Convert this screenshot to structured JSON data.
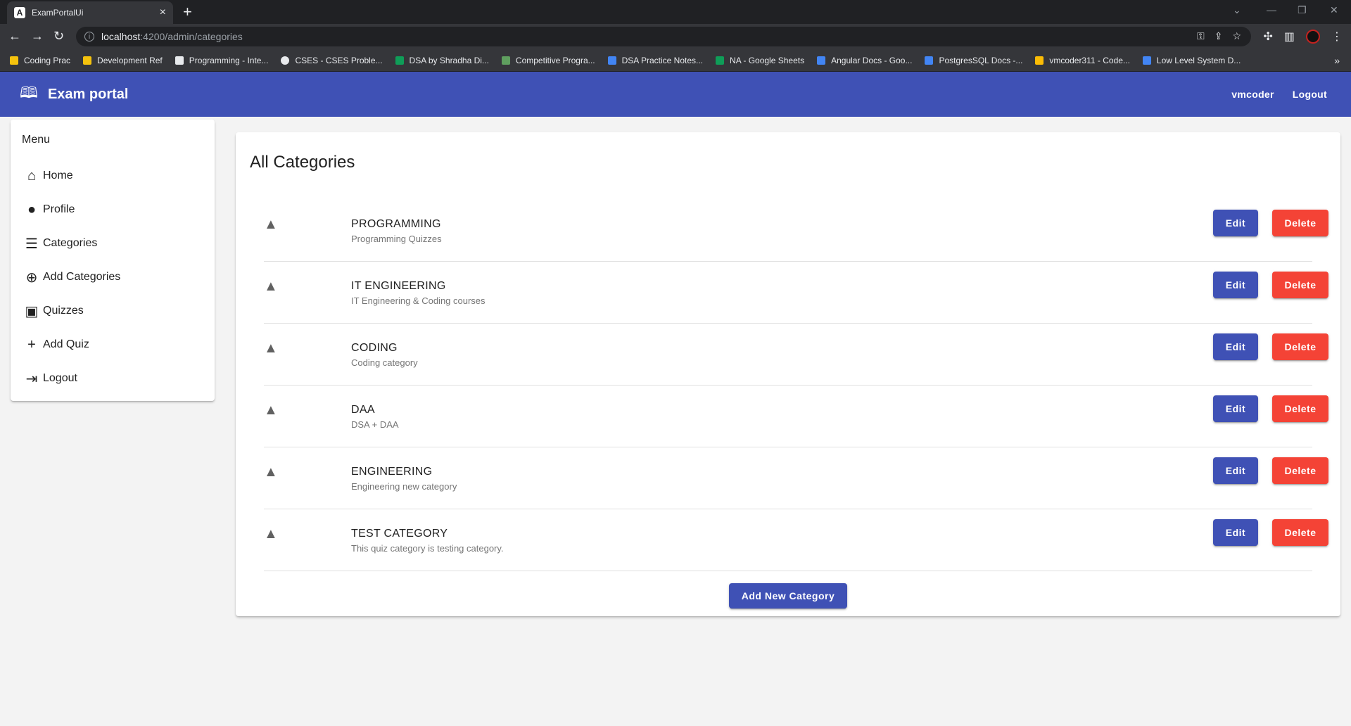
{
  "browser": {
    "tab_title": "ExamPortalUi",
    "tab_favicon": "A",
    "url_host": "localhost",
    "url_path": ":4200/admin/categories",
    "bookmarks": [
      {
        "label": "Coding Prac",
        "color": "#f4c20d"
      },
      {
        "label": "Development Ref",
        "color": "#f4c20d"
      },
      {
        "label": "Programming - Inte...",
        "color": "#ffffff"
      },
      {
        "label": "CSES - CSES Proble...",
        "color": "#e8eaed"
      },
      {
        "label": "DSA by Shradha Di...",
        "color": "#0f9d58"
      },
      {
        "label": "Competitive Progra...",
        "color": "#5f9f5f"
      },
      {
        "label": "DSA Practice Notes...",
        "color": "#4285f4"
      },
      {
        "label": "NA - Google Sheets",
        "color": "#0f9d58"
      },
      {
        "label": "Angular Docs - Goo...",
        "color": "#4285f4"
      },
      {
        "label": "PostgresSQL Docs -...",
        "color": "#4285f4"
      },
      {
        "label": "vmcoder311 - Code...",
        "color": "#fbbc05"
      },
      {
        "label": "Low Level System D...",
        "color": "#4285f4"
      }
    ],
    "bookmarks_more": "»"
  },
  "appbar": {
    "brand": "Exam portal",
    "user": "vmcoder",
    "logout": "Logout"
  },
  "sidebar": {
    "title": "Menu",
    "items": [
      {
        "label": "Home",
        "icon": "home-icon",
        "glyph": "⌂"
      },
      {
        "label": "Profile",
        "icon": "account-circle-icon",
        "glyph": "●"
      },
      {
        "label": "Categories",
        "icon": "list-icon",
        "glyph": "☰"
      },
      {
        "label": "Add Categories",
        "icon": "add-circle-icon",
        "glyph": "⊕"
      },
      {
        "label": "Quizzes",
        "icon": "quiz-icon",
        "glyph": "▣"
      },
      {
        "label": "Add Quiz",
        "icon": "add-icon",
        "glyph": "+"
      },
      {
        "label": "Logout",
        "icon": "logout-icon",
        "glyph": "⇥"
      }
    ]
  },
  "main": {
    "title": "All Categories",
    "edit_label": "Edit",
    "delete_label": "Delete",
    "add_button": "Add New Category",
    "categories": [
      {
        "name": "PROGRAMMING",
        "desc": "Programming Quizzes"
      },
      {
        "name": "IT ENGINEERING",
        "desc": "IT Engineering & Coding courses"
      },
      {
        "name": "CODING",
        "desc": "Coding category"
      },
      {
        "name": "DAA",
        "desc": "DSA + DAA"
      },
      {
        "name": "ENGINEERING",
        "desc": "Engineering new category"
      },
      {
        "name": "TEST CATEGORY",
        "desc": "This quiz category is testing category."
      }
    ]
  },
  "colors": {
    "primary": "#3f51b5",
    "warn": "#f44336"
  }
}
